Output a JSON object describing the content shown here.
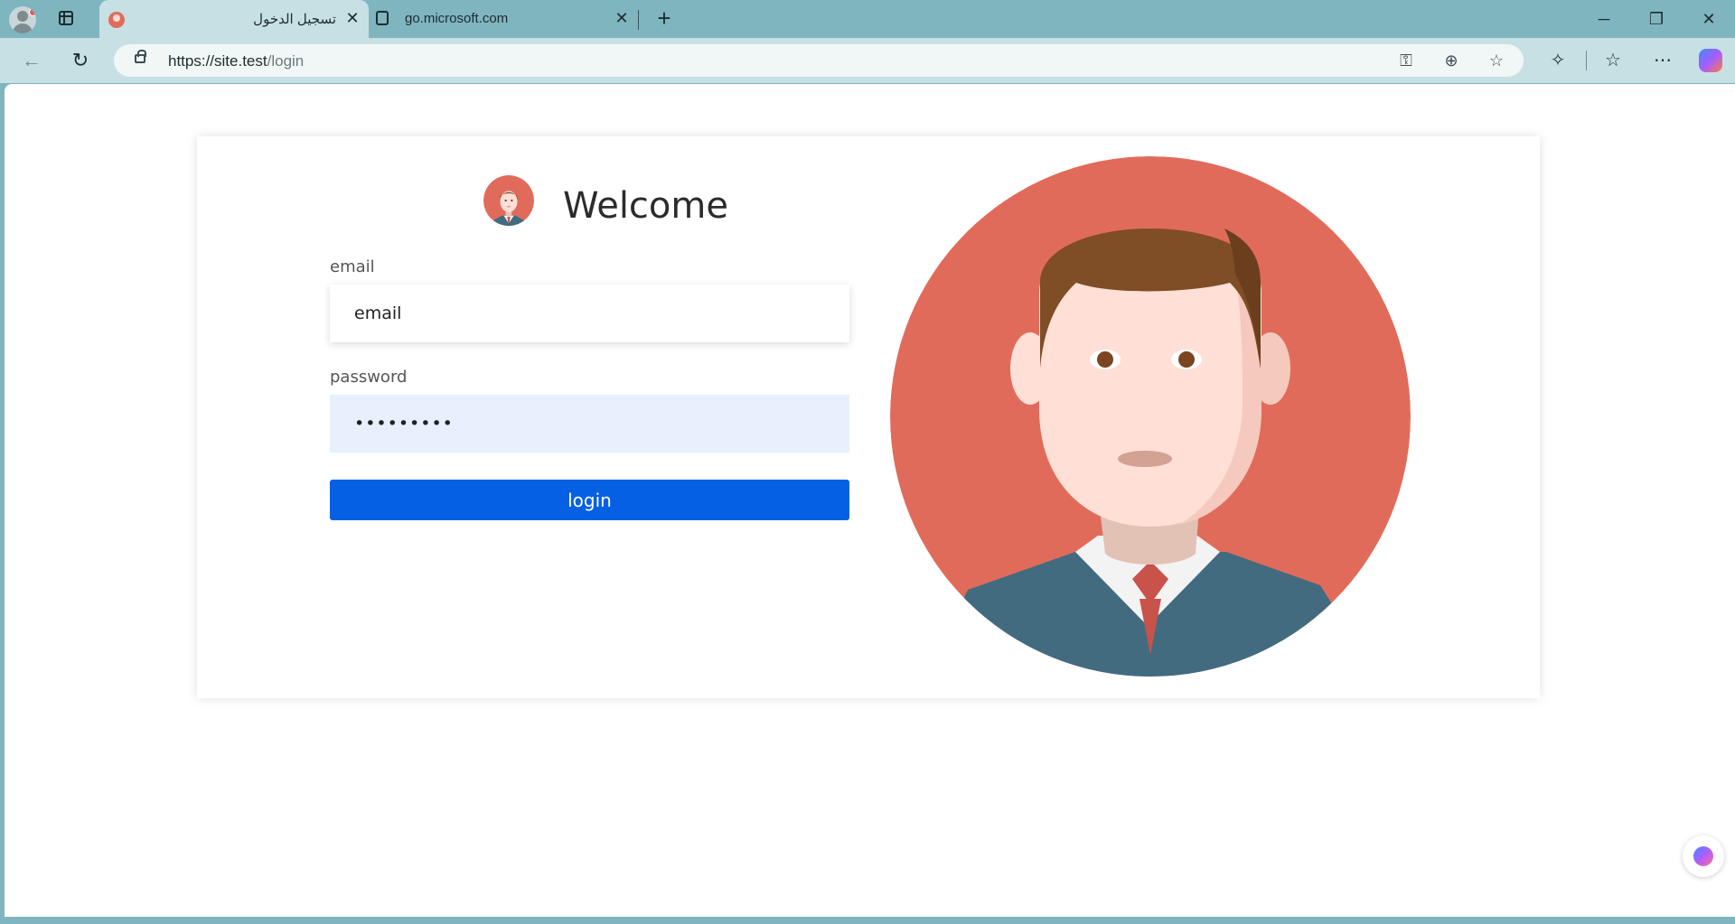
{
  "browser": {
    "tabs": [
      {
        "title": "تسجيل الدخول",
        "active": true,
        "close": "✕"
      },
      {
        "title": "go.microsoft.com",
        "active": false,
        "close": "✕"
      }
    ],
    "new_tab": "+",
    "window": {
      "minimize": "─",
      "restore": "❐",
      "close": "✕"
    },
    "nav": {
      "back": "←",
      "reload": "↻"
    },
    "url": {
      "host": "https://site.test",
      "path": "/login"
    },
    "toolbar_icons": [
      "key-icon",
      "zoom-icon",
      "star-icon",
      "extensions-icon",
      "favorites-icon",
      "more-icon",
      "copilot-icon"
    ],
    "toolbar_glyphs": {
      "key": "⚿",
      "zoom": "⊕",
      "star": "☆",
      "extensions": "✧",
      "favorites": "☆",
      "more": "⋯"
    }
  },
  "page": {
    "welcome": "Welcome",
    "email_label": "email",
    "email_value": "email",
    "password_label": "password",
    "password_value": "•••••••••",
    "login_label": "login"
  },
  "colors": {
    "accent": "#0560e4",
    "avatar_bg": "#e16b5a",
    "suit": "#426b80",
    "hair": "#7f4d26",
    "skin": "#ffdfd6"
  }
}
